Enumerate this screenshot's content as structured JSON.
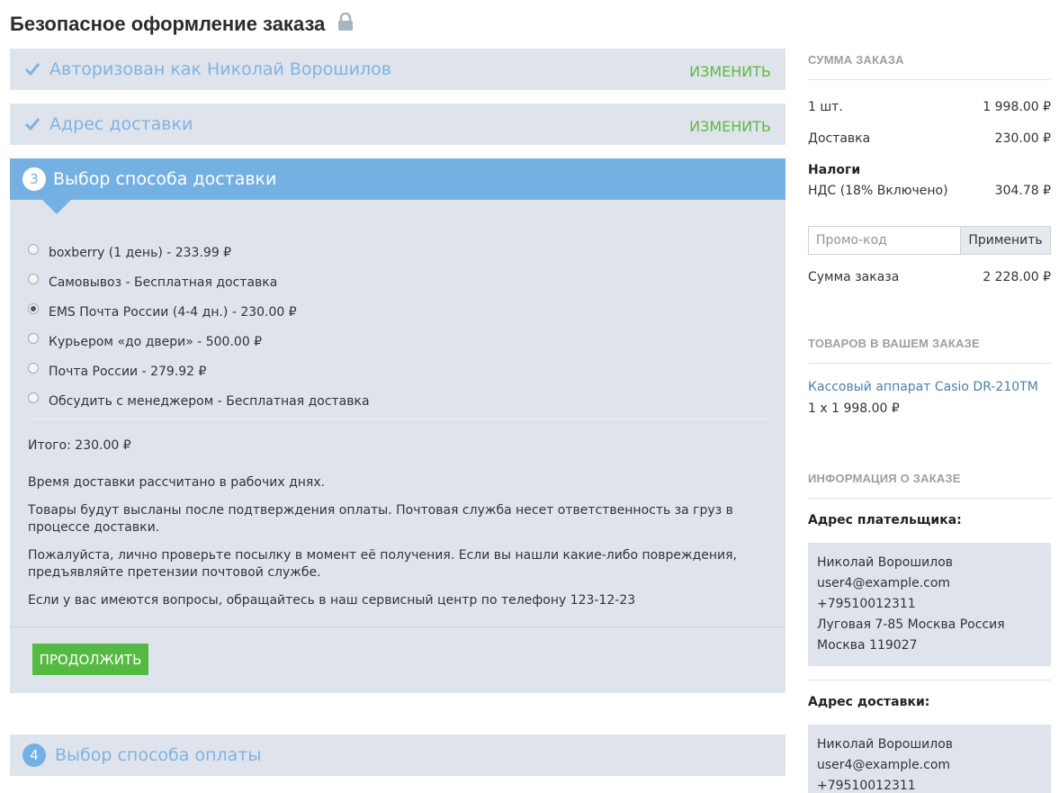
{
  "page": {
    "title": "Безопасное оформление заказа"
  },
  "steps": {
    "auth": {
      "title": "Авторизован как Николай Ворошилов",
      "edit_label": "ИЗМЕНИТЬ"
    },
    "address": {
      "title": "Адрес доставки",
      "edit_label": "ИЗМЕНИТЬ"
    },
    "shipping": {
      "number": "3",
      "title": "Выбор способа доставки",
      "options": [
        {
          "label": "boxberry (1 день) - 233.99 ₽",
          "selected": false
        },
        {
          "label": "Самовывоз - Бесплатная доставка",
          "selected": false
        },
        {
          "label": "EMS Почта России (4-4 дн.) - 230.00 ₽",
          "selected": true
        },
        {
          "label": "Курьером «до двери» - 500.00 ₽",
          "selected": false
        },
        {
          "label": "Почта России - 279.92 ₽",
          "selected": false
        },
        {
          "label": "Обсудить с менеджером - Бесплатная доставка",
          "selected": false
        }
      ],
      "total": "Итого: 230.00 ₽",
      "notes": [
        "Время доставки рассчитано в рабочих днях.",
        "Товары будут высланы после подтверждения оплаты. Почтовая служба несет ответственность за груз в процессе доставки.",
        "Пожалуйста, лично проверьте посылку в момент её получения. Если вы нашли какие-либо повреждения, предъявляйте претензии почтовой службе.",
        "Если у вас имеются вопросы, обращайтесь в наш сервисный центр по телефону 123-12-23"
      ],
      "continue_label": "ПРОДОЛЖИТЬ"
    },
    "payment": {
      "number": "4",
      "title": "Выбор способа оплаты"
    }
  },
  "sidebar": {
    "summary": {
      "heading": "СУММА ЗАКАЗА",
      "items_label": "1 шт.",
      "items_value": "1 998.00 ₽",
      "delivery_label": "Доставка",
      "delivery_value": "230.00 ₽",
      "taxes_heading": "Налоги",
      "vat_label": "НДС (18% Включено)",
      "vat_value": "304.78 ₽",
      "promo_placeholder": "Промо-код",
      "promo_button": "Применить",
      "total_label": "Сумма заказа",
      "total_value": "2 228.00 ₽"
    },
    "items": {
      "heading": "ТОВАРОВ В ВАШЕМ ЗАКАЗЕ",
      "product_name": "Кассовый аппарат Casio DR-210TM",
      "product_qty": "1 x 1 998.00 ₽"
    },
    "info": {
      "heading": "ИНФОРМАЦИЯ О ЗАКАЗЕ",
      "payer_label": "Адрес плательщика:",
      "payer_lines": [
        "Николай Ворошилов",
        "user4@example.com",
        "+79510012311",
        "Луговая 7-85 Москва Россия",
        "Москва 119027"
      ],
      "shipping_label": "Адрес доставки:",
      "shipping_lines": [
        "Николай Ворошилов",
        "user4@example.com",
        "+79510012311"
      ]
    }
  },
  "colors": {
    "accent": "#74b1e2",
    "step_bg": "#dfe4ec",
    "edit_green": "#5dbb3f",
    "button_green": "#56b942"
  },
  "icons": {
    "lock": "lock-icon",
    "check": "check-icon"
  }
}
